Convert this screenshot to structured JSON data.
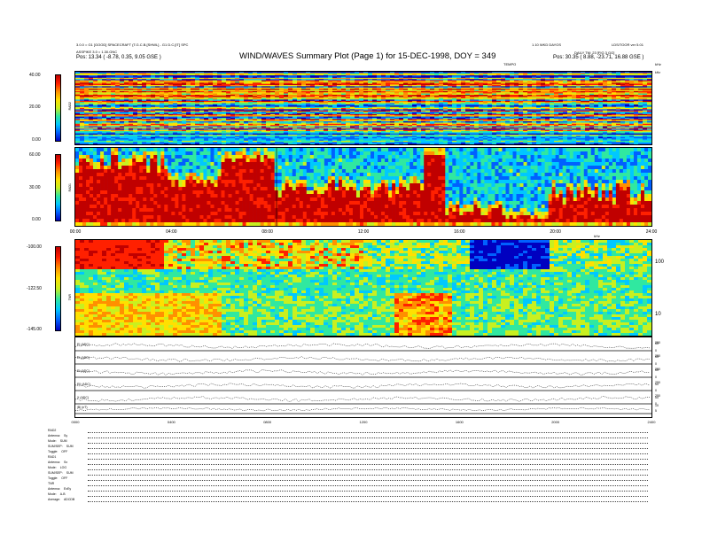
{
  "header": {
    "title": "WIND/WAVES Summary Plot (Page 1) for 15-DEC-1998, DOY = 349",
    "left_line1": "3.0.0 = G1 [GOOD] SPACECRAFT (T.G.C.B.[SHWL] - G1 D.C.[IT] SPC",
    "left_line2": "ASSPIKE 3.0 = 1.30.GNC",
    "right_line1": "1.10 WKD DAYOS",
    "right_line2": "LDS/TOOR ver 5.01",
    "right_line3": "DAILY TM: 23 [FIG 3 GG]",
    "pos_left": "Pos:  13.34 ( -8.78, 0.35, 9.05 GSE )",
    "pos_right": "Pos:  30.35 ( 8.88, -23.71, 16.88 GSE )",
    "pos_left_top": "TEMPO",
    "pos_right_top": "kHz"
  },
  "rad2": {
    "label": "RAD2",
    "ticks": [
      "40.00",
      "20.00",
      "0.00"
    ],
    "right_tick": "kHz"
  },
  "rad1": {
    "label": "RAD1",
    "ticks": [
      "60.00",
      "30.00",
      "0.00"
    ]
  },
  "time_axis_top": [
    "00:00",
    "04:00",
    "08:00",
    "12:00",
    "16:00",
    "20:00",
    "24:00"
  ],
  "tnr": {
    "label": "TNR",
    "ticks": [
      "-100.00",
      "-122.50",
      "-145.00"
    ],
    "right_ticks": [
      "100",
      "10"
    ],
    "right_top": "kHz"
  },
  "traces": [
    {
      "label": "EI (ADC)",
      "right": "250"
    },
    {
      "label": "EI (ADC)",
      "right": "250"
    },
    {
      "label": "EI (ADC)",
      "right": "250"
    },
    {
      "label": "EII (ADC)",
      "right": "250"
    },
    {
      "label": "X (ADC)",
      "right": "250"
    },
    {
      "label": "|B| (nT)",
      "right": "10"
    }
  ],
  "trace_right_extra": [
    "50",
    "0",
    "50",
    "0",
    "50",
    "0",
    "50",
    "0",
    "50",
    "0",
    "5"
  ],
  "time_axis_bottom": [
    "0000",
    "0400",
    "0800",
    "1200",
    "1600",
    "2000",
    "2400"
  ],
  "params": [
    {
      "name": "RAD2",
      "val": ""
    },
    {
      "name": "Antenna:",
      "val": "Sy"
    },
    {
      "name": "Mode:",
      "val": "SUM"
    },
    {
      "name": "SUM/SEP:",
      "val": "SUM"
    },
    {
      "name": "Toggle:",
      "val": "OFF"
    },
    {
      "name": "RAD1",
      "val": ""
    },
    {
      "name": "Antenna:",
      "val": "Sx"
    },
    {
      "name": "Mode:",
      "val": "LOG"
    },
    {
      "name": "SUM/SEP:",
      "val": "SUM"
    },
    {
      "name": "Toggle:",
      "val": "OFF"
    },
    {
      "name": "TNR",
      "val": ""
    },
    {
      "name": "Antenna:",
      "val": "ExEy"
    },
    {
      "name": "Mode:",
      "val": "A-B"
    },
    {
      "name": "Average:",
      "val": "ADCDB"
    }
  ],
  "chart_data": {
    "type": "heatmap",
    "title": "WIND/WAVES Summary Plot (Page 1) for 15-DEC-1998, DOY = 349",
    "x": [
      "00:00",
      "04:00",
      "08:00",
      "12:00",
      "16:00",
      "20:00",
      "24:00"
    ],
    "xlim": [
      0,
      24
    ],
    "panels": [
      {
        "name": "RAD2",
        "zlim": [
          0,
          40
        ]
      },
      {
        "name": "RAD1",
        "zlim": [
          0,
          60
        ]
      },
      {
        "name": "TNR",
        "zlim": [
          -145,
          -100
        ]
      }
    ],
    "colorscale": [
      "#0000c0",
      "#0060ff",
      "#00c8ff",
      "#30e8a0",
      "#c8f020",
      "#ffe000",
      "#ff9000",
      "#ff2000",
      "#c00000"
    ],
    "accent_colors": {
      "hot": "#ff2000",
      "cold": "#0038d8",
      "mid": "#30e8c8"
    }
  }
}
